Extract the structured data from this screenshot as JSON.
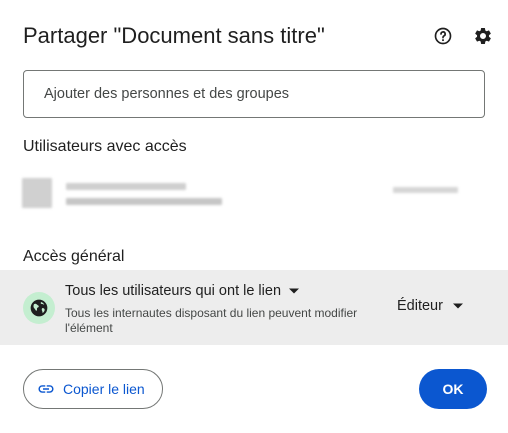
{
  "dialog": {
    "title": "Partager \"Document sans titre\"",
    "help_icon": "help-circle-icon",
    "settings_icon": "gear-icon"
  },
  "add_people": {
    "placeholder": "Ajouter des personnes et des groupes"
  },
  "users_section": {
    "label": "Utilisateurs avec accès"
  },
  "general_access": {
    "label": "Accès général",
    "globe_icon": "globe-icon",
    "scope": "Tous les utilisateurs qui ont le lien",
    "description": "Tous les internautes disposant du lien peuvent modifier l'élément",
    "role": "Éditeur"
  },
  "footer": {
    "copy_link_label": "Copier le lien",
    "ok_label": "OK"
  },
  "colors": {
    "accent": "#0b57d0",
    "row_background": "#ededed",
    "globe_background": "#c4eed0"
  }
}
